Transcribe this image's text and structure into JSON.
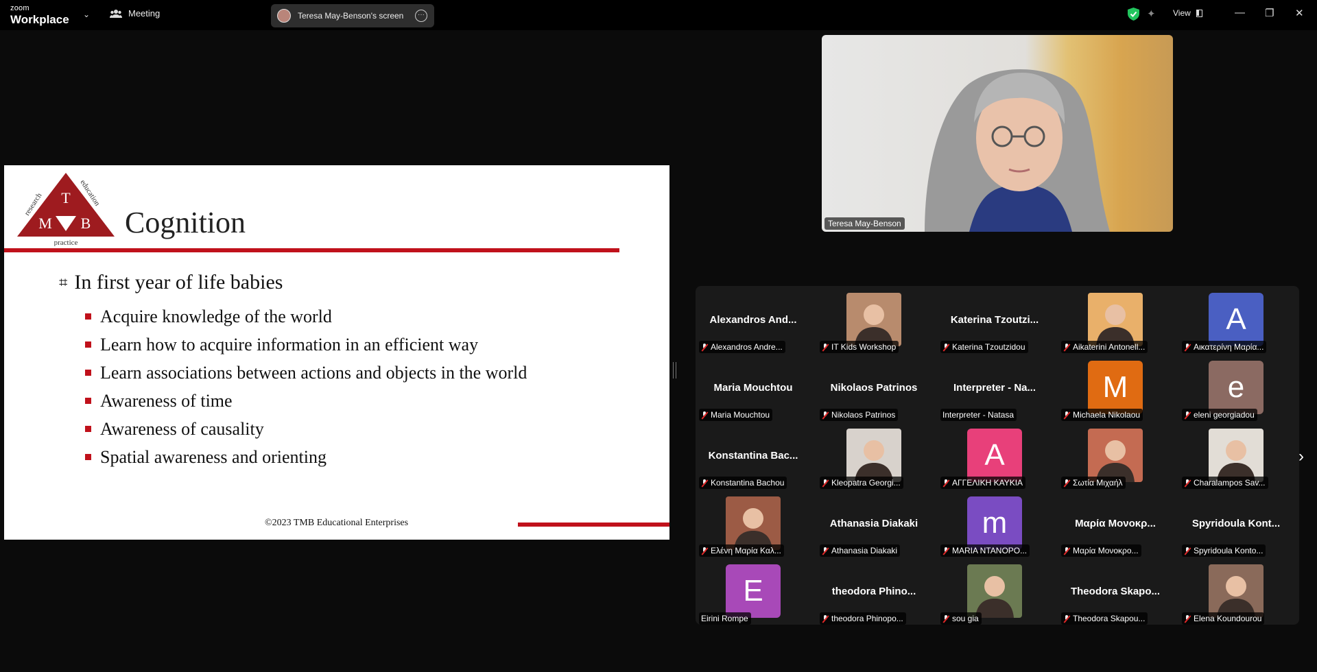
{
  "topbar": {
    "brand_small": "zoom",
    "brand_big": "Workplace",
    "meeting_label": "Meeting",
    "share_label": "Teresa May-Benson's screen",
    "view_label": "View"
  },
  "slide": {
    "logo_top": "research",
    "logo_right": "education",
    "logo_bottom": "practice",
    "logo_letters": [
      "T",
      "M",
      "B"
    ],
    "title": "Cognition",
    "main_bullet": "In first year of life babies",
    "sub_bullets": [
      "Acquire knowledge of the world",
      "Learn how to acquire information in an efficient way",
      "Learn associations between actions and objects in the world",
      "Awareness of time",
      "Awareness of causality",
      "Spatial awareness and orienting"
    ],
    "footer": "©2023 TMB Educational Enterprises"
  },
  "speaker": {
    "name": "Teresa May-Benson"
  },
  "gallery": {
    "participants": [
      {
        "display": "Alexandros  And...",
        "label": "Alexandros Andre...",
        "type": "name"
      },
      {
        "display": "",
        "label": "IT Kids Workshop",
        "type": "photo",
        "color": "#b88b6d"
      },
      {
        "display": "Katerina  Tzoutzi...",
        "label": "Katerina Tzoutzidou",
        "type": "name"
      },
      {
        "display": "",
        "label": "Aikaterini Antonell...",
        "type": "photo",
        "color": "#e9b06a"
      },
      {
        "display": "A",
        "label": "Αικατερίνη Μαρία...",
        "type": "avatar",
        "color": "#4a5fc2"
      },
      {
        "display": "Maria Mouchtou",
        "label": "Maria Mouchtou",
        "type": "name"
      },
      {
        "display": "Nikolaos Patrinos",
        "label": "Nikolaos Patrinos",
        "type": "name"
      },
      {
        "display": "Interpreter - Na...",
        "label": "Interpreter - Natasa",
        "type": "name",
        "unmuted": true
      },
      {
        "display": "M",
        "label": "Michaela Nikolaou",
        "type": "avatar",
        "color": "#e06b12"
      },
      {
        "display": "e",
        "label": "eleni georgiadou",
        "type": "avatar",
        "color": "#8b6a62"
      },
      {
        "display": "Konstantina  Bac...",
        "label": "Konstantina Bachou",
        "type": "name"
      },
      {
        "display": "",
        "label": "Kleopatra Georgi...",
        "type": "photo",
        "color": "#d8d2cc"
      },
      {
        "display": "A",
        "label": "ΑΓΓΕΛΙΚΗ ΚΑΥΚΙΑ",
        "type": "avatar",
        "color": "#e8407a"
      },
      {
        "display": "",
        "label": "Σωτία Μιχαήλ",
        "type": "photo",
        "color": "#c46b52"
      },
      {
        "display": "",
        "label": "Charalampos Sav...",
        "type": "photo",
        "color": "#e2ddd6"
      },
      {
        "display": "",
        "label": "Ελένη Μαρία Καλ...",
        "type": "photo",
        "color": "#9c5b45"
      },
      {
        "display": "Athanasia Diakaki",
        "label": "Athanasia Diakaki",
        "type": "name"
      },
      {
        "display": "m",
        "label": "MARIA NTANOPO...",
        "type": "avatar",
        "color": "#7a4cc2"
      },
      {
        "display": "Μαρία  Μονοκρ...",
        "label": "Μαρία Μονοκρο...",
        "type": "name"
      },
      {
        "display": "Spyridoula  Kont...",
        "label": "Spyridoula Konto...",
        "type": "name"
      },
      {
        "display": "E",
        "label": "Eirini Rompe",
        "type": "avatar",
        "color": "#a849b8",
        "unmuted": true
      },
      {
        "display": "theodora  Phino...",
        "label": "theodora Phinopo...",
        "type": "name"
      },
      {
        "display": "",
        "label": "sou gia",
        "type": "photo",
        "color": "#6b7a52"
      },
      {
        "display": "Theodora  Skapo...",
        "label": "Theodora Skapou...",
        "type": "name"
      },
      {
        "display": "",
        "label": "Elena Koundourou",
        "type": "photo",
        "color": "#8a6a5a"
      }
    ]
  }
}
